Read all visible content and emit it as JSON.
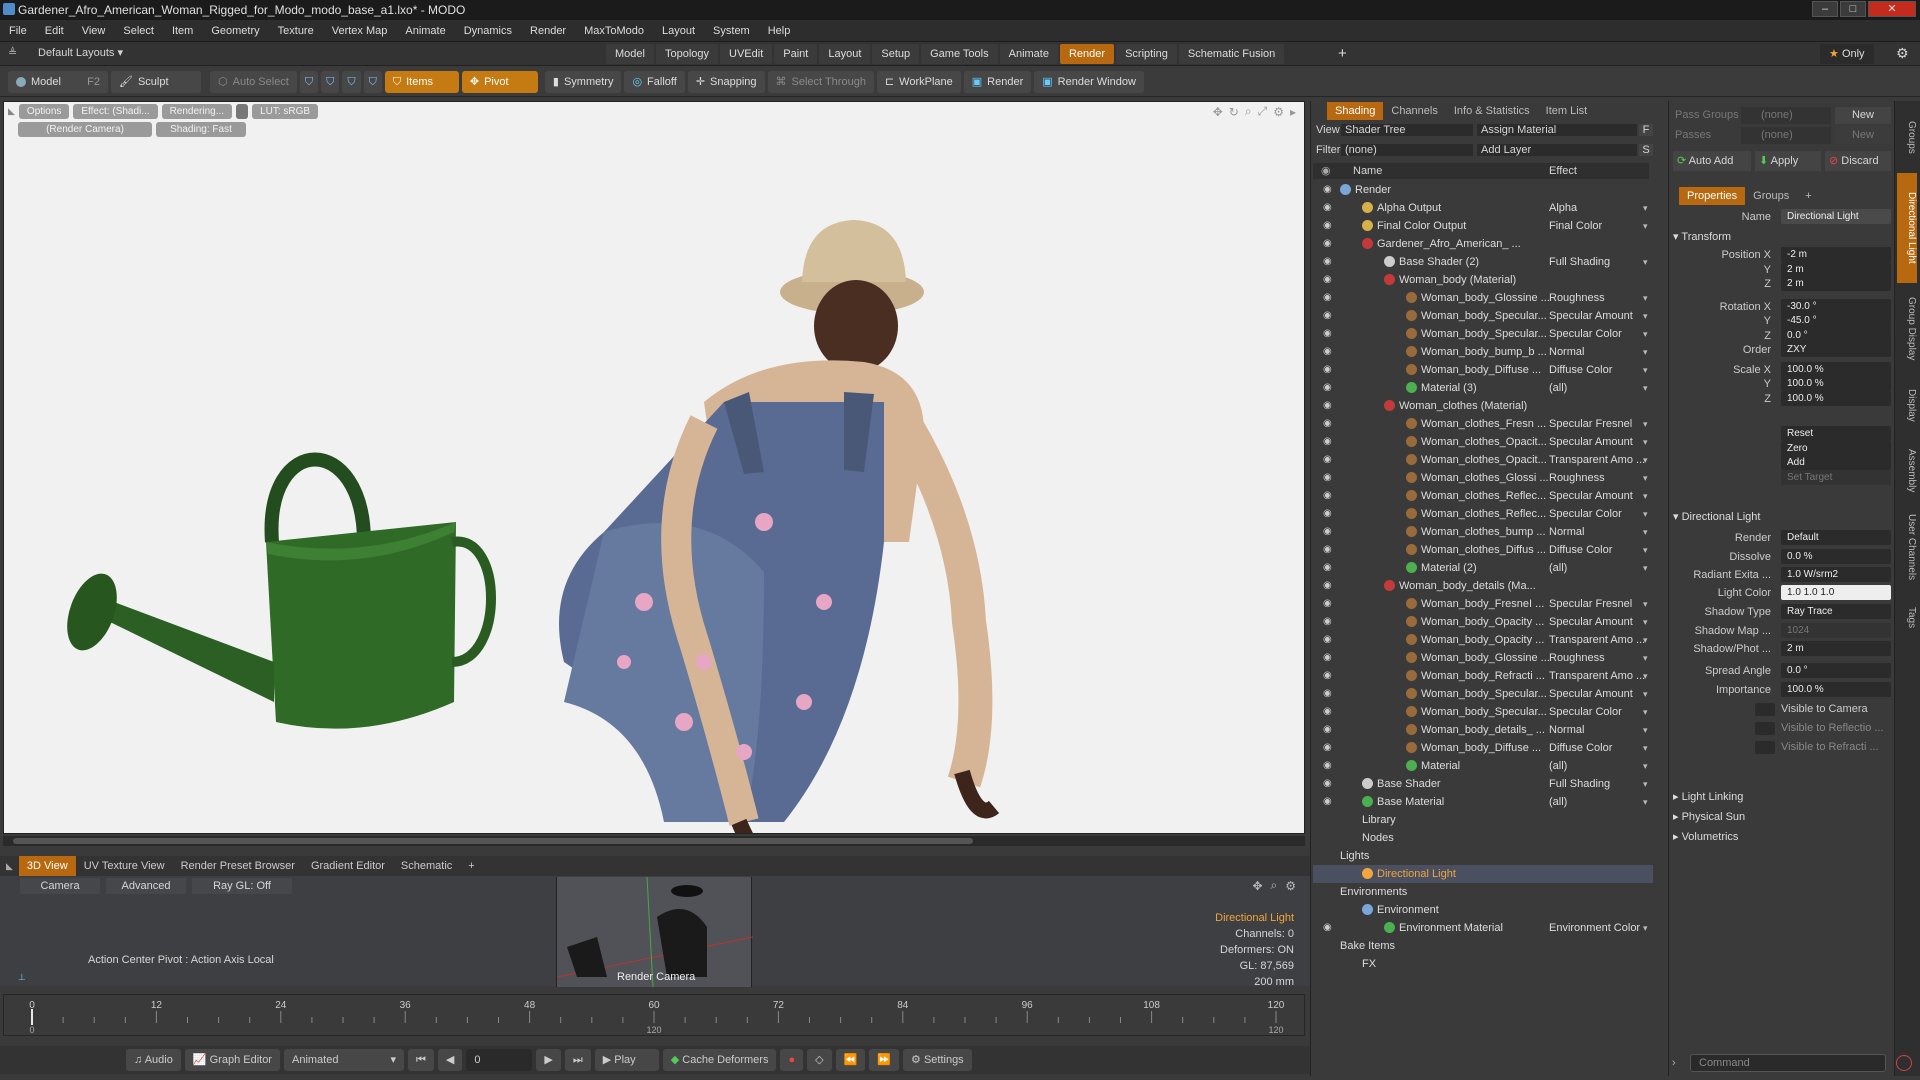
{
  "window": {
    "title": "Gardener_Afro_American_Woman_Rigged_for_Modo_modo_base_a1.lxo* - MODO"
  },
  "menu": [
    "File",
    "Edit",
    "View",
    "Select",
    "Item",
    "Geometry",
    "Texture",
    "Vertex Map",
    "Animate",
    "Dynamics",
    "Render",
    "MaxToModo",
    "Layout",
    "System",
    "Help"
  ],
  "layoutbar": {
    "preset": "Default Layouts ▾",
    "tabs": [
      "Model",
      "Topology",
      "UVEdit",
      "Paint",
      "Layout",
      "Setup",
      "Game Tools",
      "Animate",
      "Render",
      "Scripting",
      "Schematic Fusion"
    ],
    "active": "Render",
    "only": "Only"
  },
  "toolbar": {
    "model": "Model",
    "f2": "F2",
    "sculpt": "Sculpt",
    "auto_select": "Auto Select",
    "items": "Items",
    "pivot": "Pivot",
    "symmetry": "Symmetry",
    "falloff": "Falloff",
    "snapping": "Snapping",
    "select_through": "Select Through",
    "workplane": "WorkPlane",
    "render": "Render",
    "render_window": "Render Window"
  },
  "viewport": {
    "chips_row1": [
      "Options",
      "Effect: (Shadi...",
      "Rendering...",
      "LUT: sRGB"
    ],
    "chips_row2": [
      "(Render Camera)",
      "Shading: Fast"
    ]
  },
  "bottom": {
    "tabs": [
      "3D View",
      "UV Texture View",
      "Render Preset Browser",
      "Gradient Editor",
      "Schematic"
    ],
    "camera_tabs": [
      "Camera",
      "Advanced",
      "Ray GL: Off"
    ],
    "action_center": "Action Center Pivot : Action Axis Local",
    "render_camera": "Render Camera",
    "info": [
      "Directional Light",
      "Channels: 0",
      "Deformers: ON",
      "GL: 87,569",
      "200 mm"
    ]
  },
  "timeline": {
    "ticks": [
      "0",
      "12",
      "24",
      "36",
      "48",
      "60",
      "72",
      "84",
      "96",
      "108",
      "120"
    ],
    "sub": [
      "0",
      "120",
      "120"
    ]
  },
  "transport": {
    "audio": "Audio",
    "graph_editor": "Graph Editor",
    "animated": "Animated",
    "frame": "0",
    "play": "Play",
    "cache": "Cache Deformers",
    "settings": "Settings"
  },
  "shading": {
    "tabs": [
      "Shading",
      "Channels",
      "Info & Statistics",
      "Item List"
    ],
    "view_label": "View",
    "view_value": "Shader Tree",
    "assign": "Assign Material",
    "f": "F",
    "filter_label": "Filter",
    "filter_value": "(none)",
    "add_layer": "Add Layer",
    "s": "S",
    "col_name": "Name",
    "col_effect": "Effect",
    "rows": [
      {
        "n": "Render",
        "e": "",
        "i": 1,
        "c": "#7aa7d8"
      },
      {
        "n": "Alpha Output",
        "e": "Alpha",
        "i": 3,
        "c": "#d8b04a"
      },
      {
        "n": "Final Color Output",
        "e": "Final Color",
        "i": 3,
        "c": "#d8b04a"
      },
      {
        "n": "Gardener_Afro_American_ ...",
        "e": "",
        "i": 3,
        "c": "#c23a3a"
      },
      {
        "n": "Base Shader (2)",
        "e": "Full Shading",
        "i": 5,
        "c": "#cccccc"
      },
      {
        "n": "Woman_body (Material)",
        "e": "",
        "i": 5,
        "c": "#c23a3a"
      },
      {
        "n": "Woman_body_Glossine ...",
        "e": "Roughness",
        "i": 7,
        "c": "#9a6b3a"
      },
      {
        "n": "Woman_body_Specular...",
        "e": "Specular Amount",
        "i": 7,
        "c": "#9a6b3a"
      },
      {
        "n": "Woman_body_Specular...",
        "e": "Specular Color",
        "i": 7,
        "c": "#9a6b3a"
      },
      {
        "n": "Woman_body_bump_b ...",
        "e": "Normal",
        "i": 7,
        "c": "#9a6b3a"
      },
      {
        "n": "Woman_body_Diffuse ...",
        "e": "Diffuse Color",
        "i": 7,
        "c": "#9a6b3a"
      },
      {
        "n": "Material (3)",
        "e": "(all)",
        "i": 7,
        "c": "#4caf50"
      },
      {
        "n": "Woman_clothes (Material)",
        "e": "",
        "i": 5,
        "c": "#c23a3a"
      },
      {
        "n": "Woman_clothes_Fresn ...",
        "e": "Specular Fresnel",
        "i": 7,
        "c": "#9a6b3a"
      },
      {
        "n": "Woman_clothes_Opacit...",
        "e": "Specular Amount",
        "i": 7,
        "c": "#9a6b3a"
      },
      {
        "n": "Woman_clothes_Opacit...",
        "e": "Transparent Amo ...",
        "i": 7,
        "c": "#9a6b3a"
      },
      {
        "n": "Woman_clothes_Glossi ...",
        "e": "Roughness",
        "i": 7,
        "c": "#9a6b3a"
      },
      {
        "n": "Woman_clothes_Reflec...",
        "e": "Specular Amount",
        "i": 7,
        "c": "#9a6b3a"
      },
      {
        "n": "Woman_clothes_Reflec...",
        "e": "Specular Color",
        "i": 7,
        "c": "#9a6b3a"
      },
      {
        "n": "Woman_clothes_bump ...",
        "e": "Normal",
        "i": 7,
        "c": "#9a6b3a"
      },
      {
        "n": "Woman_clothes_Diffus ...",
        "e": "Diffuse Color",
        "i": 7,
        "c": "#9a6b3a"
      },
      {
        "n": "Material (2)",
        "e": "(all)",
        "i": 7,
        "c": "#4caf50"
      },
      {
        "n": "Woman_body_details (Ma...",
        "e": "",
        "i": 5,
        "c": "#c23a3a"
      },
      {
        "n": "Woman_body_FresneI ...",
        "e": "Specular Fresnel",
        "i": 7,
        "c": "#9a6b3a"
      },
      {
        "n": "Woman_body_Opacity ...",
        "e": "Specular Amount",
        "i": 7,
        "c": "#9a6b3a"
      },
      {
        "n": "Woman_body_Opacity ...",
        "e": "Transparent Amo ...",
        "i": 7,
        "c": "#9a6b3a"
      },
      {
        "n": "Woman_body_Glossine ...",
        "e": "Roughness",
        "i": 7,
        "c": "#9a6b3a"
      },
      {
        "n": "Woman_body_Refracti ...",
        "e": "Transparent Amo ...",
        "i": 7,
        "c": "#9a6b3a"
      },
      {
        "n": "Woman_body_Specular...",
        "e": "Specular Amount",
        "i": 7,
        "c": "#9a6b3a"
      },
      {
        "n": "Woman_body_Specular...",
        "e": "Specular Color",
        "i": 7,
        "c": "#9a6b3a"
      },
      {
        "n": "Woman_body_details_ ...",
        "e": "Normal",
        "i": 7,
        "c": "#9a6b3a"
      },
      {
        "n": "Woman_body_Diffuse ...",
        "e": "Diffuse Color",
        "i": 7,
        "c": "#9a6b3a"
      },
      {
        "n": "Material",
        "e": "(all)",
        "i": 7,
        "c": "#4caf50"
      },
      {
        "n": "Base Shader",
        "e": "Full Shading",
        "i": 3,
        "c": "#cccccc"
      },
      {
        "n": "Base Material",
        "e": "(all)",
        "i": 3,
        "c": "#4caf50"
      },
      {
        "n": "Library",
        "e": "",
        "i": 3,
        "c": ""
      },
      {
        "n": "Nodes",
        "e": "",
        "i": 3,
        "c": ""
      },
      {
        "n": "Lights",
        "e": "",
        "i": 1,
        "c": ""
      },
      {
        "n": "Directional Light",
        "e": "",
        "i": 3,
        "c": "#f1a53a"
      },
      {
        "n": "Environments",
        "e": "",
        "i": 1,
        "c": ""
      },
      {
        "n": "Environment",
        "e": "",
        "i": 3,
        "c": "#7aa7d8"
      },
      {
        "n": "Environment Material",
        "e": "Environment Color",
        "i": 5,
        "c": "#4caf50"
      },
      {
        "n": "Bake Items",
        "e": "",
        "i": 1,
        "c": ""
      },
      {
        "n": "FX",
        "e": "",
        "i": 3,
        "c": ""
      }
    ],
    "selected": "Directional Light"
  },
  "props": {
    "pass_groups": "Pass Groups",
    "passes": "Passes",
    "none": "(none)",
    "new": "New",
    "auto_add": "Auto Add",
    "apply": "Apply",
    "discard": "Discard",
    "tabs": [
      "Properties",
      "Groups"
    ],
    "name_label": "Name",
    "name_value": "Directional Light",
    "transform": "Transform",
    "fields": [
      {
        "l": "Position X",
        "v": "-2 m"
      },
      {
        "l": "Y",
        "v": "2 m"
      },
      {
        "l": "Z",
        "v": "2 m"
      },
      {
        "l": "Rotation X",
        "v": "-30.0 °"
      },
      {
        "l": "Y",
        "v": "-45.0 °"
      },
      {
        "l": "Z",
        "v": "0.0 °"
      },
      {
        "l": "Order",
        "v": "ZXY"
      },
      {
        "l": "Scale X",
        "v": "100.0 %"
      },
      {
        "l": "Y",
        "v": "100.0 %"
      },
      {
        "l": "Z",
        "v": "100.0 %"
      }
    ],
    "buttons": [
      "Reset",
      "Zero",
      "Add",
      "Set Target"
    ],
    "dl_section": "Directional Light",
    "dl_fields": [
      {
        "l": "Render",
        "v": "Default"
      },
      {
        "l": "Dissolve",
        "v": "0.0 %"
      },
      {
        "l": "Radiant Exita ...",
        "v": "1.0 W/srm2"
      },
      {
        "l": "Light Color",
        "v": "1.0      1.0      1.0"
      },
      {
        "l": "Shadow Type",
        "v": "Ray Trace"
      },
      {
        "l": "Shadow Map ...",
        "v": "1024"
      },
      {
        "l": "Shadow/Phot ...",
        "v": "2 m"
      },
      {
        "l": "Spread Angle",
        "v": "0.0 °"
      },
      {
        "l": "Importance",
        "v": "100.0 %"
      }
    ],
    "checks": [
      "Visible to Camera",
      "Visible to Reflectio ...",
      "Visible to Refracti ..."
    ],
    "sections": [
      "Light Linking",
      "Physical Sun",
      "Volumetrics"
    ],
    "command": "Command"
  },
  "sidetabs": [
    "Groups",
    "Directional Light",
    "Group Display",
    "Display",
    "Assembly",
    "User Channels",
    "Tags"
  ]
}
